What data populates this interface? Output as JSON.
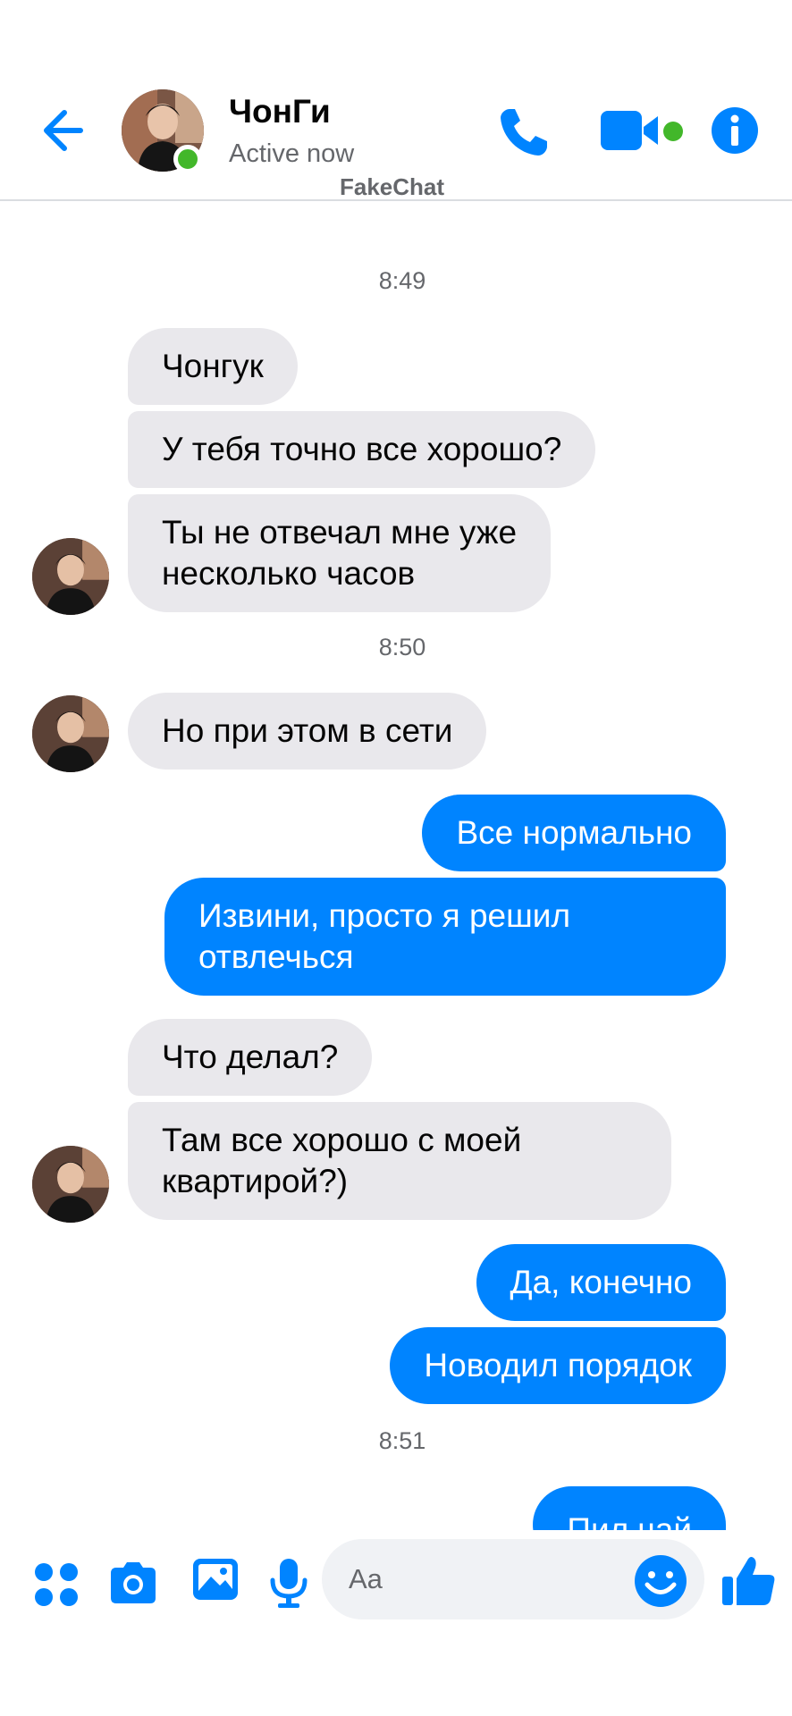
{
  "header": {
    "contact_name": "ЧонГи",
    "status": "Active now",
    "watermark": "FakeChat",
    "icons": [
      "back-arrow-icon",
      "phone-icon",
      "video-camera-icon",
      "info-icon"
    ],
    "accent_color": "#0084ff",
    "online_color": "#42b72a"
  },
  "conversation": {
    "timestamps": [
      "8:49",
      "8:50",
      "8:51"
    ],
    "messages": [
      {
        "from": "contact",
        "text": [
          "Чонгук"
        ]
      },
      {
        "from": "contact",
        "text": [
          "У тебя точно все хорошо?"
        ]
      },
      {
        "from": "contact",
        "text": [
          "Ты не отвечал мне уже",
          "несколько часов"
        ]
      },
      {
        "from": "contact",
        "text": [
          "Но при этом в сети"
        ]
      },
      {
        "from": "me",
        "text": [
          "Все нормально"
        ]
      },
      {
        "from": "me",
        "text": [
          "Извини, просто я решил",
          "отвлечься"
        ]
      },
      {
        "from": "contact",
        "text": [
          "Что делал?"
        ]
      },
      {
        "from": "contact",
        "text": [
          "Там все хорошо с моей",
          "квартирой?)"
        ]
      },
      {
        "from": "me",
        "text": [
          "Да, конечно"
        ]
      },
      {
        "from": "me",
        "text": [
          "Новодил порядок"
        ]
      },
      {
        "from": "me",
        "text": [
          "Пил чай"
        ]
      }
    ],
    "incoming_bubble_color": "#e9e8ec",
    "outgoing_bubble_color": "#0084ff"
  },
  "composer": {
    "placeholder": "Aa",
    "icons": [
      "menu-dots-icon",
      "camera-icon",
      "image-icon",
      "microphone-icon",
      "emoji-icon",
      "thumbs-up-icon"
    ]
  }
}
